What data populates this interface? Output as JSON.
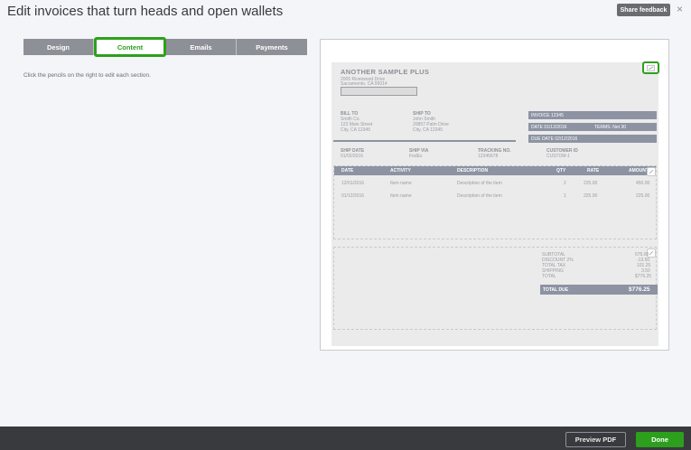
{
  "header": {
    "title": "Edit invoices that turn heads and open wallets",
    "share_feedback": "Share feedback",
    "close": "×"
  },
  "tabs": [
    {
      "label": "Design"
    },
    {
      "label": "Content",
      "active": true
    },
    {
      "label": "Emails"
    },
    {
      "label": "Payments"
    }
  ],
  "hint": "Click the pencils on the right to edit each section.",
  "invoice": {
    "company": "ANOTHER SAMPLE PLUS",
    "address1": "2005 Riverwood Drive",
    "address2": "Sacramento, CA 95014",
    "bill_to_label": "BILL TO",
    "bill_to": [
      "Smith Co.",
      "123 Main Street",
      "City, CA 12345"
    ],
    "ship_to_label": "SHIP TO",
    "ship_to": [
      "John Smith",
      "20857 Palm Drive",
      "City, CA 12345"
    ],
    "invoice_no": "INVOICE 12345",
    "date": "DATE 01/12/2016",
    "terms": "TERMS: Net 30",
    "due_date": "DUE DATE 02/12/2016",
    "ship_date_label": "SHIP DATE",
    "ship_date": "01/02/2016",
    "ship_via_label": "SHIP VIA",
    "ship_via": "FedEx",
    "tracking_label": "TRACKING NO.",
    "tracking": "12345678",
    "customer_id_label": "CUSTOMER ID",
    "customer_id": "CUSTOM-1",
    "columns": [
      "DATE",
      "ACTIVITY",
      "DESCRIPTION",
      "QTY",
      "RATE",
      "AMOUNT"
    ],
    "rows": [
      {
        "date": "12/01/2016",
        "activity": "Item name",
        "description": "Description of the item",
        "qty": "2",
        "rate": "225.00",
        "amount": "450.00"
      },
      {
        "date": "01/12/2016",
        "activity": "Item name",
        "description": "Description of the item",
        "qty": "1",
        "rate": "225.00",
        "amount": "225.00"
      }
    ],
    "totals": {
      "subtotal_label": "SUBTOTAL",
      "subtotal": "675.00",
      "discount_label": "DISCOUNT 2%",
      "discount": "-13.50",
      "tax_label": "TOTAL TAX",
      "tax": "101.25",
      "shipping_label": "SHIPPING",
      "shipping": "3.50",
      "total_label": "TOTAL",
      "total": "$776.25",
      "total_due_label": "TOTAL DUE",
      "total_due": "$776.25"
    }
  },
  "footer": {
    "preview_pdf": "Preview PDF",
    "done": "Done"
  },
  "colors": {
    "accent": "#2ca01c",
    "footer_bg": "#393a3d",
    "invoice_bar": "#8d93a3"
  }
}
